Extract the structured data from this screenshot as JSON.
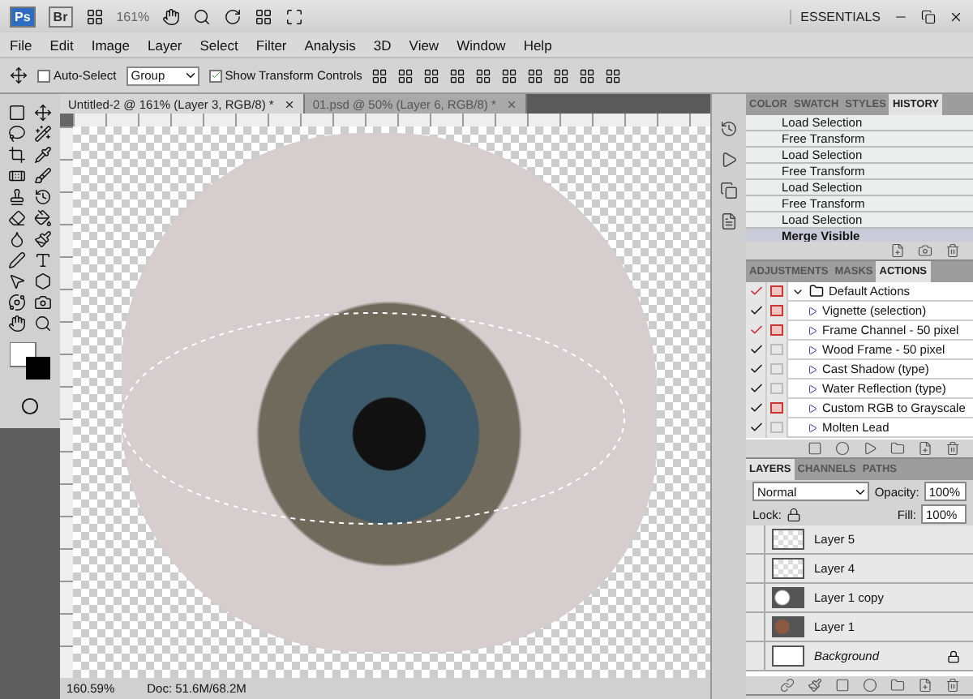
{
  "app_bar": {
    "logo": "Ps",
    "bridge": "Br",
    "zoom": "161%",
    "workspace": "ESSENTIALS"
  },
  "menu": [
    "File",
    "Edit",
    "Image",
    "Layer",
    "Select",
    "Filter",
    "Analysis",
    "3D",
    "View",
    "Window",
    "Help"
  ],
  "options_bar": {
    "auto_select": {
      "label": "Auto-Select",
      "checked": false
    },
    "auto_select_target": "Group",
    "show_transform": {
      "label": "Show Transform Controls",
      "checked": true
    }
  },
  "document_tabs": [
    {
      "title": "Untitled-2 @ 161% (Layer 3, RGB/8) *",
      "selected": true
    },
    {
      "title": "01.psd @ 50% (Layer 6, RGB/8) *",
      "selected": false
    }
  ],
  "status_bar": {
    "zoom": "160.59%",
    "doc_size": "Doc: 51.6M/68.2M"
  },
  "history_panel": {
    "tabs": [
      {
        "label": "COLOR",
        "selected": false
      },
      {
        "label": "SWATCH",
        "selected": false
      },
      {
        "label": "STYLES",
        "selected": false
      },
      {
        "label": "HISTORY",
        "selected": true
      }
    ],
    "items": [
      {
        "label": "Load Selection",
        "selected": false
      },
      {
        "label": "Free Transform",
        "selected": false
      },
      {
        "label": "Load Selection",
        "selected": false
      },
      {
        "label": "Free Transform",
        "selected": false
      },
      {
        "label": "Load Selection",
        "selected": false
      },
      {
        "label": "Free Transform",
        "selected": false
      },
      {
        "label": "Load Selection",
        "selected": false
      },
      {
        "label": "Merge Visible",
        "selected": true
      }
    ]
  },
  "actions_panel": {
    "tabs": [
      {
        "label": "ADJUSTMENTS",
        "selected": false
      },
      {
        "label": "MASKS",
        "selected": false
      },
      {
        "label": "ACTIONS",
        "selected": true
      }
    ],
    "items": [
      {
        "kind": "set",
        "label": "Default Actions",
        "partial": true,
        "dialog": true,
        "expanded": true
      },
      {
        "kind": "action",
        "label": "Vignette (selection)",
        "partial": false,
        "dialog": true
      },
      {
        "kind": "action",
        "label": "Frame Channel - 50 pixel",
        "partial": true,
        "dialog": true
      },
      {
        "kind": "action",
        "label": "Wood Frame - 50 pixel",
        "partial": false,
        "dialog": false
      },
      {
        "kind": "action",
        "label": "Cast Shadow (type)",
        "partial": false,
        "dialog": false
      },
      {
        "kind": "action",
        "label": "Water Reflection (type)",
        "partial": false,
        "dialog": false
      },
      {
        "kind": "action",
        "label": "Custom RGB to Grayscale",
        "partial": false,
        "dialog": true
      },
      {
        "kind": "action",
        "label": "Molten Lead",
        "partial": false,
        "dialog": false
      }
    ]
  },
  "layers_panel": {
    "tabs": [
      {
        "label": "LAYERS",
        "selected": true
      },
      {
        "label": "CHANNELS",
        "selected": false
      },
      {
        "label": "PATHS",
        "selected": false
      }
    ],
    "blend_mode": "Normal",
    "opacity_label": "Opacity:",
    "opacity": "100%",
    "lock_label": "Lock:",
    "fill_label": "Fill:",
    "fill": "100%",
    "layers": [
      {
        "name": "Layer 5",
        "kind": "transparent",
        "locked": false
      },
      {
        "name": "Layer 4",
        "kind": "transparent",
        "locked": false
      },
      {
        "name": "Layer 1 copy",
        "kind": "mask",
        "locked": false
      },
      {
        "name": "Layer 1",
        "kind": "photo",
        "locked": false
      },
      {
        "name": "Background",
        "kind": "white",
        "locked": true
      }
    ]
  }
}
